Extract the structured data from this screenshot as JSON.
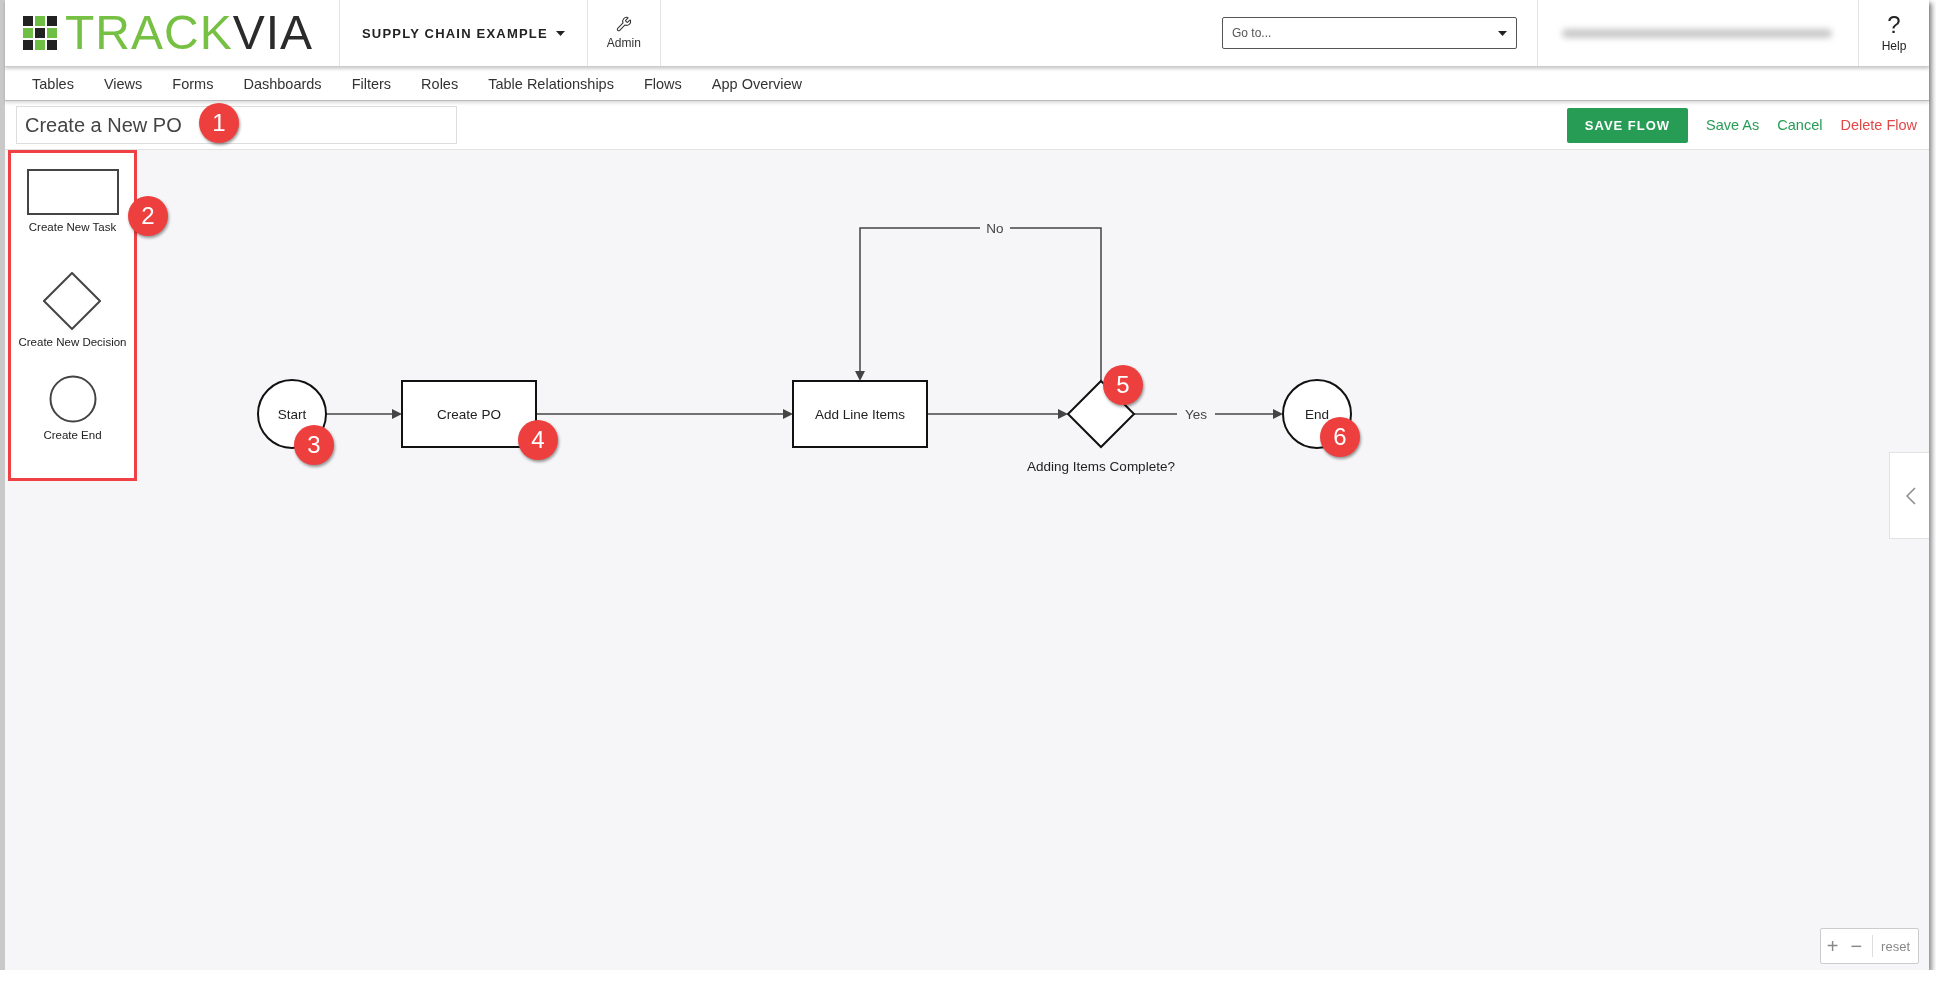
{
  "header": {
    "logo_green": "TRACK",
    "logo_dark": "VIA",
    "app_menu": "SUPPLY CHAIN EXAMPLE",
    "admin": "Admin",
    "goto": {
      "placeholder": "Go to..."
    },
    "help": {
      "icon": "?",
      "label": "Help"
    }
  },
  "nav": [
    "Tables",
    "Views",
    "Forms",
    "Dashboards",
    "Filters",
    "Roles",
    "Table Relationships",
    "Flows",
    "App Overview"
  ],
  "toolbar": {
    "flow_name": "Create a New PO",
    "buttons": [
      {
        "kind": "primary",
        "label": "SAVE FLOW"
      },
      {
        "kind": "link",
        "label": "Save As"
      },
      {
        "kind": "link",
        "label": "Cancel"
      },
      {
        "kind": "danger",
        "label": "Delete Flow"
      }
    ]
  },
  "palette": [
    {
      "kind": "task",
      "label": "Create New Task"
    },
    {
      "kind": "decision",
      "label": "Create New Decision"
    },
    {
      "kind": "end",
      "label": "Create End"
    }
  ],
  "flow": {
    "nodes": [
      {
        "kind": "start",
        "label": "Start"
      },
      {
        "kind": "task",
        "label": "Create PO"
      },
      {
        "kind": "task",
        "label": "Add Line Items"
      },
      {
        "kind": "decision",
        "caption": "Adding Items Complete?"
      },
      {
        "kind": "end",
        "label": "End"
      }
    ],
    "edge_labels": [
      {
        "kind": "no",
        "label": "No"
      },
      {
        "kind": "yes",
        "label": "Yes"
      }
    ]
  },
  "annotations": [
    "1",
    "2",
    "3",
    "4",
    "5",
    "6"
  ],
  "zoom": {
    "plus": "+",
    "minus": "−",
    "reset": "reset"
  }
}
